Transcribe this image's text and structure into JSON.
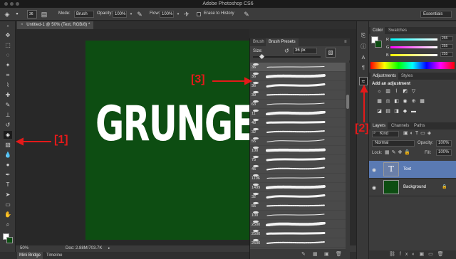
{
  "app": {
    "title": "Adobe Photoshop CS6"
  },
  "options_bar": {
    "brush_size": "36",
    "mode_label": "Mode:",
    "mode_value": "Brush",
    "opacity_label": "Opacity:",
    "opacity_value": "100%",
    "flow_label": "Flow:",
    "flow_value": "100%",
    "erase_history_label": "Erase to History",
    "workspace_value": "Essentials"
  },
  "document": {
    "tab_title": "Untitled-1 @ 50% (Text, RGB/8) *",
    "canvas_text": "GRUNGE",
    "canvas_color": "#0d4d12"
  },
  "status_bar": {
    "zoom": "50%",
    "doc_info": "Doc: 2.88M/703.7K"
  },
  "bottom_tabs": [
    "Mini Bridge",
    "Timeline"
  ],
  "brush_panel": {
    "tabs": [
      "Brush",
      "Brush Presets"
    ],
    "size_label": "Size:",
    "size_value": "36 px",
    "presets": [
      {
        "label": "36",
        "selected": true
      },
      {
        "label": "36"
      },
      {
        "label": "36"
      },
      {
        "label": "39"
      },
      {
        "label": "63"
      },
      {
        "label": "11"
      },
      {
        "label": "48"
      },
      {
        "label": "32"
      },
      {
        "label": "55"
      },
      {
        "label": "100"
      },
      {
        "label": "75"
      },
      {
        "label": "45"
      },
      {
        "label": "1106"
      },
      {
        "label": "1499"
      },
      {
        "label": "32"
      },
      {
        "label": "55"
      },
      {
        "label": "100"
      },
      {
        "label": "2500"
      },
      {
        "label": "2500"
      },
      {
        "label": "2500"
      }
    ]
  },
  "color_panel": {
    "tabs": [
      "Color",
      "Swatches"
    ],
    "channels": [
      {
        "label": "R",
        "value": "255"
      },
      {
        "label": "G",
        "value": "255"
      },
      {
        "label": "B",
        "value": "255"
      }
    ]
  },
  "adjustments_panel": {
    "tabs": [
      "Adjustments",
      "Styles"
    ],
    "heading": "Add an adjustment"
  },
  "layers_panel": {
    "tabs": [
      "Layers",
      "Channels",
      "Paths"
    ],
    "kind_filter": "Kind",
    "blend_mode": "Normal",
    "opacity_label": "Opacity:",
    "opacity_value": "100%",
    "lock_label": "Lock:",
    "fill_label": "Fill:",
    "fill_value": "100%",
    "layers": [
      {
        "name": "Text",
        "type": "text",
        "selected": true
      },
      {
        "name": "Background",
        "type": "fill",
        "selected": false
      }
    ]
  },
  "annotations": {
    "a1": "[1]",
    "a2": "[2]",
    "a3": "[3]"
  },
  "colors": {
    "annotation_red": "#e41a1a",
    "canvas_green": "#0d4d12",
    "layer_selected": "#5a7ab3"
  }
}
